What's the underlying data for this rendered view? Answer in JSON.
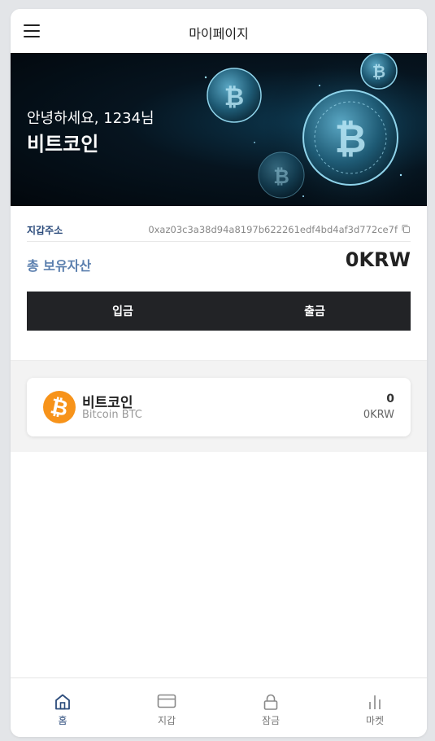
{
  "header": {
    "title": "마이페이지",
    "menu_icon": "hamburger-menu-icon"
  },
  "hero": {
    "greeting": "안녕하세요, 1234님",
    "coin_title": "비트코인"
  },
  "wallet": {
    "label": "지갑주소",
    "address": "0xaz03c3a38d94a8197b622261edf4bd4af3d772ce7f",
    "copy_icon": "copy-icon"
  },
  "assets": {
    "label": "총 보유자산",
    "value": "0KRW"
  },
  "actions": {
    "deposit_label": "입금",
    "withdraw_label": "출금"
  },
  "coins": [
    {
      "name": "비트코인",
      "sub": "Bitcoin BTC",
      "amount": "0",
      "krw": "0KRW",
      "icon": "bitcoin-icon",
      "icon_color": "#f7931a"
    }
  ],
  "nav": [
    {
      "label": "홈",
      "icon": "home-icon",
      "active": true
    },
    {
      "label": "지갑",
      "icon": "wallet-card-icon",
      "active": false
    },
    {
      "label": "잠금",
      "icon": "lock-icon",
      "active": false
    },
    {
      "label": "마켓",
      "icon": "bar-chart-icon",
      "active": false
    }
  ],
  "colors": {
    "accent": "#2b4b7b",
    "dark_button": "#222326",
    "bitcoin": "#f7931a"
  }
}
